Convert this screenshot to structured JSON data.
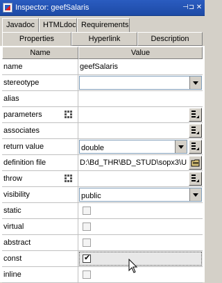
{
  "window": {
    "title": "Inspector: geefSalaris",
    "pin_glyph": "⊣⊐",
    "close_glyph": "✕"
  },
  "tabs_top": [
    {
      "label": "Javadoc"
    },
    {
      "label": "HTMLdoc"
    },
    {
      "label": "Requirements"
    }
  ],
  "tabs_bottom": [
    {
      "label": "Properties",
      "active": true
    },
    {
      "label": "Hyperlink",
      "active": false
    },
    {
      "label": "Description",
      "active": false
    }
  ],
  "grid": {
    "header_name": "Name",
    "header_value": "Value",
    "rows": [
      {
        "label": "name",
        "value": "geefSalaris",
        "kind": "text"
      },
      {
        "label": "stereotype",
        "value": "",
        "kind": "combo"
      },
      {
        "label": "alias",
        "value": "",
        "kind": "text"
      },
      {
        "label": "parameters",
        "value": "",
        "kind": "button",
        "multi": true
      },
      {
        "label": "associates",
        "value": "",
        "kind": "button"
      },
      {
        "label": "return value",
        "value": "double",
        "kind": "combo-button"
      },
      {
        "label": "definition file",
        "value": "D:\\Bd_THR\\BD_STUD\\sopx3\\U...",
        "kind": "file"
      },
      {
        "label": "throw",
        "value": "",
        "kind": "button",
        "multi": true
      },
      {
        "label": "visibility",
        "value": "public",
        "kind": "combo-full"
      },
      {
        "label": "static",
        "checked": false,
        "kind": "check"
      },
      {
        "label": "virtual",
        "checked": false,
        "kind": "check"
      },
      {
        "label": "abstract",
        "checked": false,
        "kind": "check"
      },
      {
        "label": "const",
        "checked": true,
        "kind": "check",
        "selected": true
      },
      {
        "label": "inline",
        "checked": false,
        "kind": "check"
      }
    ]
  },
  "colors": {
    "title_bar": "#1d4aa6",
    "panel_bg": "#d4d0c8",
    "grid_line": "#c0c0c0"
  }
}
